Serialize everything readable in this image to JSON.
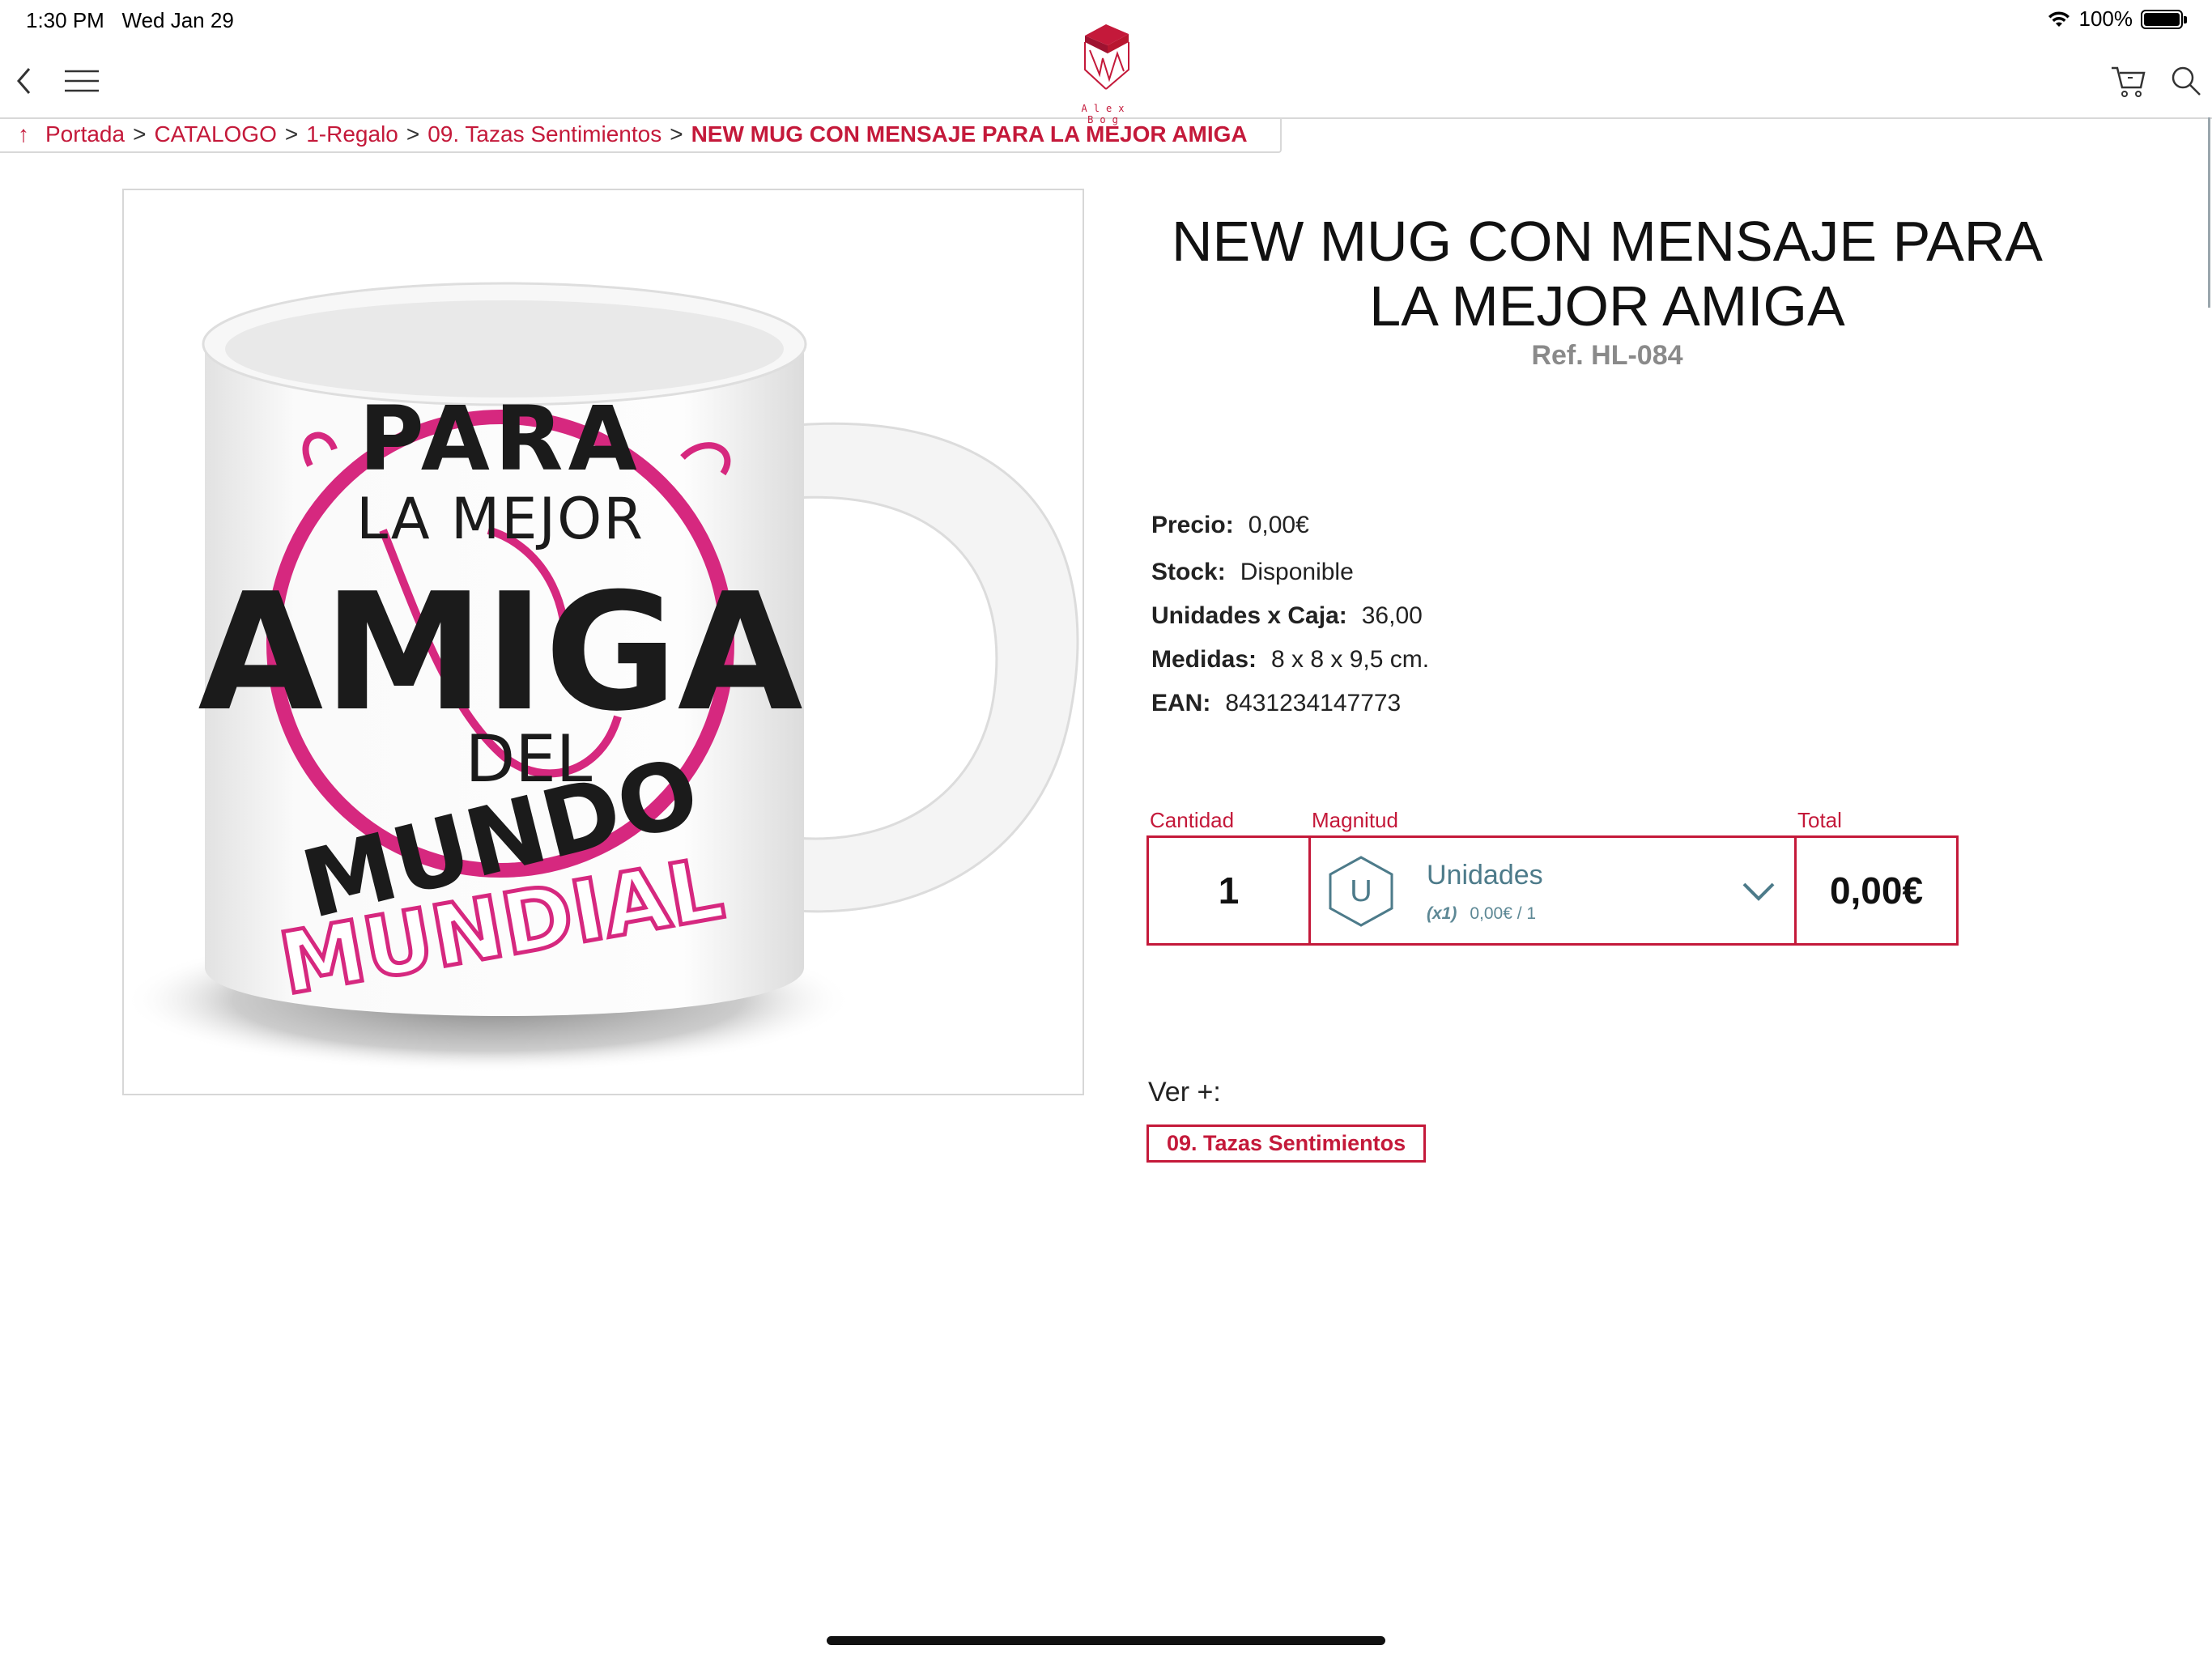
{
  "status_bar": {
    "time": "1:30 PM",
    "date": "Wed Jan 29",
    "battery": "100%"
  },
  "brand": {
    "logo_text": "Alex Bog"
  },
  "breadcrumb": {
    "up_arrow": "↑",
    "items": [
      "Portada",
      "CATALOGO",
      "1-Regalo",
      "09. Tazas Sentimientos"
    ],
    "current": "NEW MUG CON MENSAJE PARA LA MEJOR AMIGA",
    "separator": ">"
  },
  "product": {
    "title_line1": "NEW MUG CON MENSAJE PARA",
    "title_line2": "LA MEJOR AMIGA",
    "ref": "Ref. HL-084",
    "image_text": {
      "line1": "PARA",
      "line2": "LA MEJOR",
      "line3": "AMIGA",
      "line4": "DEL",
      "line5": "MUNDO",
      "line6": "MUNDIAL"
    },
    "specs": [
      {
        "label": "Precio:",
        "value": "0,00€"
      },
      {
        "label": "Stock:",
        "value": "Disponible"
      },
      {
        "label": "Unidades x Caja:",
        "value": "36,00"
      },
      {
        "label": "Medidas:",
        "value": "8 x 8 x 9,5 cm."
      },
      {
        "label": "EAN:",
        "value": "8431234147773"
      }
    ]
  },
  "order": {
    "qty_label": "Cantidad",
    "mag_label": "Magnitud",
    "total_label": "Total",
    "quantity": "1",
    "unit_letter": "U",
    "unit_name": "Unidades",
    "unit_multiplier": "(x1)",
    "unit_price": "0,00€ / 1",
    "total": "0,00€"
  },
  "related": {
    "label": "Ver +:",
    "tag": "09. Tazas Sentimientos"
  },
  "colors": {
    "accent": "#c4193a",
    "teal": "#4d7b8a",
    "pink": "#d6287f"
  }
}
